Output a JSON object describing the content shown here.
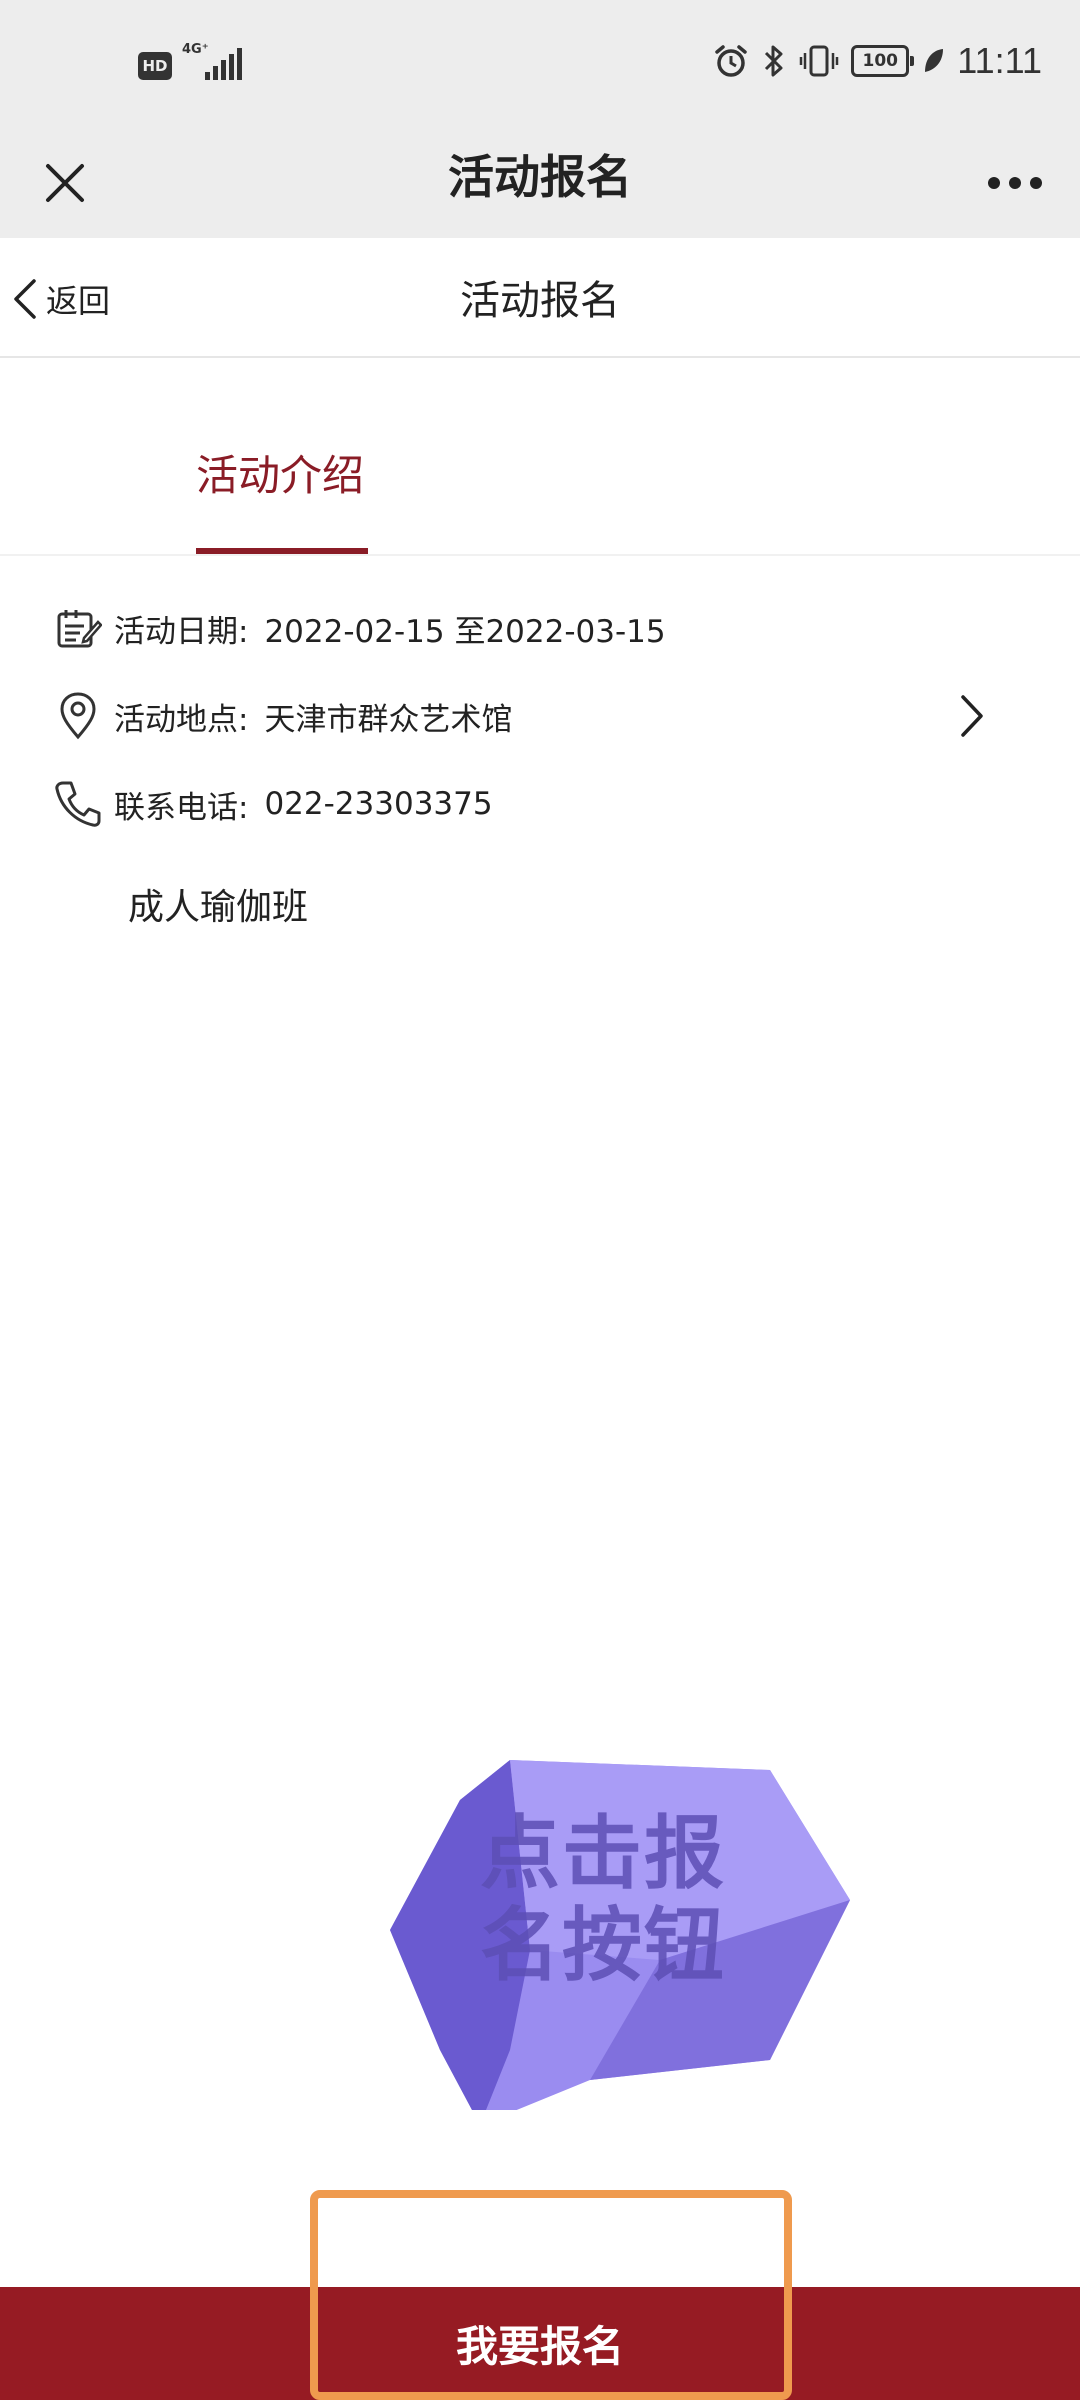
{
  "status_bar": {
    "hd_badge": "HD",
    "network_type": "4G⁺",
    "battery_level": "100",
    "time": "11:11"
  },
  "wechat_header": {
    "title": "活动报名",
    "close_icon": "close-icon",
    "more_icon": "more-dots-icon"
  },
  "page_nav": {
    "back_label": "返回",
    "title": "活动报名"
  },
  "tabs": [
    {
      "label": "活动介绍",
      "active": true
    }
  ],
  "info": {
    "date": {
      "label": "活动日期:",
      "value": "2022-02-15 至2022-03-15",
      "icon": "calendar-edit-icon"
    },
    "location": {
      "label": "活动地点:",
      "value": "天津市群众艺术馆",
      "icon": "location-pin-icon"
    },
    "phone": {
      "label": "联系电话:",
      "value": "022-23303375",
      "icon": "phone-icon"
    }
  },
  "description": "成人瑜伽班",
  "callout": {
    "line1": "点击报",
    "line2": "名按钮"
  },
  "action": {
    "signup_label": "我要报名"
  },
  "colors": {
    "accent": "#8a1c26",
    "bottom_bar": "#961b23",
    "highlight": "#ef9a4e",
    "bubble": "#8f80e8"
  }
}
